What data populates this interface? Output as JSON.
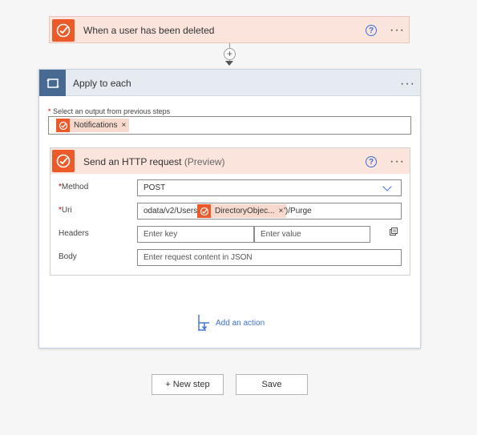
{
  "trigger": {
    "title": "When a user has been deleted",
    "help": "?",
    "more": "···"
  },
  "connector": {
    "plus": "+"
  },
  "loop": {
    "title": "Apply to each",
    "more": "···",
    "select_label": "Select an output from previous steps",
    "required_mark": "*",
    "selected_token": "Notifications",
    "token_remove": "×"
  },
  "http": {
    "title": "Send an HTTP request",
    "subtitle": "(Preview)",
    "help": "?",
    "more": "···",
    "fields": {
      "method_label": "Method",
      "method_value": "POST",
      "uri_label": "Uri",
      "uri_prefix": "odata/v2/Users('",
      "uri_token": "DirectoryObjec...",
      "uri_token_remove": "×",
      "uri_suffix": "')/Purge",
      "headers_label": "Headers",
      "headers_key_placeholder": "Enter key",
      "headers_value_placeholder": "Enter value",
      "body_label": "Body",
      "body_placeholder": "Enter request content in JSON"
    }
  },
  "add_action": {
    "label": "Add an action"
  },
  "buttons": {
    "new_step": "+ New step",
    "save": "Save"
  },
  "colors": {
    "office_orange": "#eb5a28",
    "loop_blue": "#486991",
    "link_blue": "#3b6ed6"
  }
}
